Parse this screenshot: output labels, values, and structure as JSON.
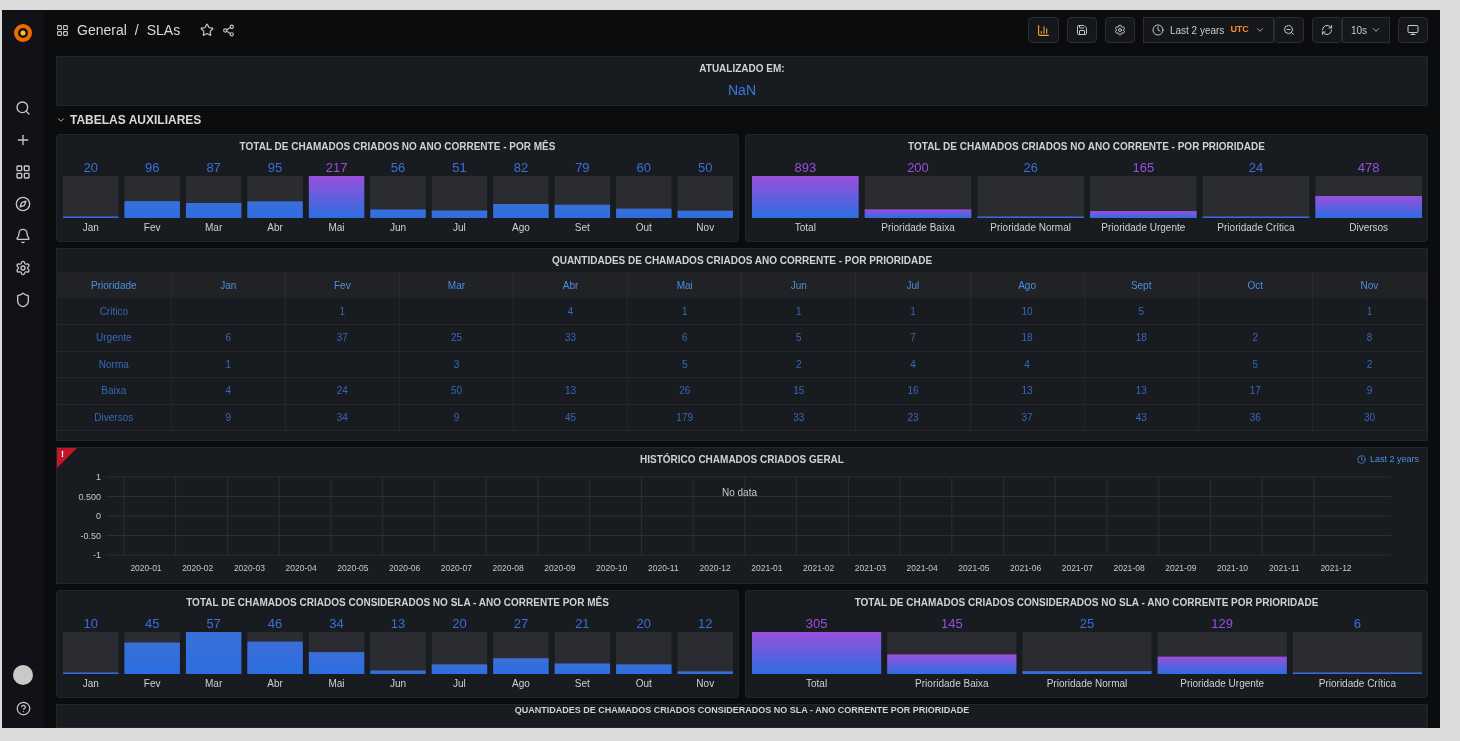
{
  "breadcrumb": {
    "folder": "General",
    "separator": "/",
    "title": "SLAs"
  },
  "toolbar": {
    "time_range": "Last 2 years",
    "timezone": "UTC",
    "refresh_interval": "10s"
  },
  "updated_panel": {
    "title": "ATUALIZADO EM:",
    "value": "NaN"
  },
  "row": {
    "title": "TABELAS AUXILIARES",
    "expanded": true
  },
  "panels_top": [
    {
      "title": "TOTAL DE CHAMADOS CRIADOS NO ANO CORRENTE - POR MÊS",
      "chart_data": {
        "type": "bar",
        "categories": [
          "Jan",
          "Fev",
          "Mar",
          "Abr",
          "Mai",
          "Jun",
          "Jul",
          "Ago",
          "Set",
          "Out",
          "Nov"
        ],
        "values": [
          20,
          96,
          87,
          95,
          217,
          56,
          51,
          82,
          79,
          60,
          50
        ],
        "colors": [
          "#3b6fd8",
          "#3b6fd8",
          "#3b6fd8",
          "#3b6fd8",
          "#9a4fdc",
          "#3b6fd8",
          "#3b6fd8",
          "#3b6fd8",
          "#3b6fd8",
          "#3b6fd8",
          "#3b6fd8"
        ],
        "ylim": [
          15,
          217
        ],
        "data_labels": true
      }
    },
    {
      "title": "TOTAL DE CHAMADOS CRIADOS NO ANO CORRENTE - POR PRIORIDADE",
      "chart_data": {
        "type": "bar",
        "categories": [
          "Total",
          "Prioridade Baixa",
          "Prioridade Normal",
          "Prioridade Urgente",
          "Prioridade Crítica",
          "Diversos"
        ],
        "values": [
          893,
          200,
          26,
          165,
          24,
          478
        ],
        "colors": [
          "#9a4fdc",
          "#9a4fdc",
          "#3b6fd8",
          "#9a4fdc",
          "#3b6fd8",
          "#9a4fdc"
        ],
        "ylim": [
          20,
          893
        ],
        "data_labels": true
      }
    }
  ],
  "table_panel": {
    "title": "QUANTIDADES DE CHAMADOS CRIADOS ANO CORRENTE - POR PRIORIDADE",
    "columns": [
      "Prioridade",
      "Jan",
      "Fev",
      "Mar",
      "Abr",
      "Mai",
      "Jun",
      "Jul",
      "Ago",
      "Sept",
      "Oct",
      "Nov"
    ],
    "rows": [
      [
        "Critico",
        "",
        "1",
        "",
        "4",
        "1",
        "1",
        "1",
        "10",
        "5",
        "",
        "1"
      ],
      [
        "Urgente",
        "6",
        "37",
        "25",
        "33",
        "6",
        "5",
        "7",
        "18",
        "18",
        "2",
        "8"
      ],
      [
        "Norma",
        "1",
        "",
        "3",
        "",
        "5",
        "2",
        "4",
        "4",
        "",
        "5",
        "2"
      ],
      [
        "Baixa",
        "4",
        "24",
        "50",
        "13",
        "26",
        "15",
        "16",
        "13",
        "13",
        "17",
        "9"
      ],
      [
        "Diversos",
        "9",
        "34",
        "9",
        "45",
        "179",
        "33",
        "23",
        "37",
        "43",
        "36",
        "30"
      ]
    ]
  },
  "history_panel": {
    "title": "HISTÓRICO CHAMADOS CRIADOS GERAL",
    "error": true,
    "error_symbol": "!",
    "time_info": "Last 2 years",
    "message": "No data",
    "chart_data": {
      "type": "line",
      "x": [
        "2020-01",
        "2020-02",
        "2020-03",
        "2020-04",
        "2020-05",
        "2020-06",
        "2020-07",
        "2020-08",
        "2020-09",
        "2020-10",
        "2020-11",
        "2020-12",
        "2021-01",
        "2021-02",
        "2021-03",
        "2021-04",
        "2021-05",
        "2021-06",
        "2021-07",
        "2021-08",
        "2021-09",
        "2021-10",
        "2021-11",
        "2021-12"
      ],
      "ylim": [
        -1,
        1
      ],
      "grid": true,
      "yticks": [
        {
          "value": 1,
          "label": "1"
        },
        {
          "value": 0.5,
          "label": "0.500"
        },
        {
          "value": 0,
          "label": "0"
        },
        {
          "value": -0.5,
          "label": "-0.50"
        },
        {
          "value": -1,
          "label": "-1"
        }
      ]
    }
  },
  "panels_bottom": [
    {
      "title": "TOTAL DE CHAMADOS CRIADOS CONSIDERADOS NO SLA - ANO CORRENTE POR MÊS",
      "chart_data": {
        "type": "bar",
        "categories": [
          "Jan",
          "Fev",
          "Mar",
          "Abr",
          "Mai",
          "Jun",
          "Jul",
          "Ago",
          "Set",
          "Out",
          "Nov"
        ],
        "values": [
          10,
          45,
          57,
          46,
          34,
          13,
          20,
          27,
          21,
          20,
          12
        ],
        "colors": [
          "#3b6fd8",
          "#3b6fd8",
          "#3b6fd8",
          "#3b6fd8",
          "#3b6fd8",
          "#3b6fd8",
          "#3b6fd8",
          "#3b6fd8",
          "#3b6fd8",
          "#3b6fd8",
          "#3b6fd8"
        ],
        "ylim": [
          9,
          57
        ],
        "data_labels": true
      }
    },
    {
      "title": "TOTAL DE CHAMADOS CRIADOS CONSIDERADOS NO SLA - ANO CORRENTE POR PRIORIDADE",
      "chart_data": {
        "type": "bar",
        "categories": [
          "Total",
          "Prioridade Baixa",
          "Prioridade Normal",
          "Prioridade Urgente",
          "Prioridade Crítica"
        ],
        "values": [
          305,
          145,
          25,
          129,
          6
        ],
        "colors": [
          "#9a4fdc",
          "#9a4fdc",
          "#3b6fd8",
          "#9a4fdc",
          "#3b6fd8"
        ],
        "ylim": [
          5,
          305
        ],
        "data_labels": true
      }
    }
  ],
  "next_panel": {
    "title": "QUANTIDADES DE CHAMADOS CRIADOS CONSIDERADOS NO SLA - ANO CORRENTE POR PRIORIDADE"
  }
}
